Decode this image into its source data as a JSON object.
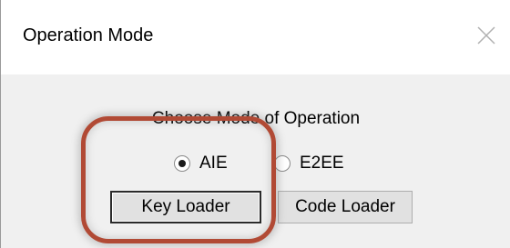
{
  "window": {
    "title": "Operation Mode",
    "close_icon": "close-icon"
  },
  "content": {
    "prompt": "Choose Mode of Operation",
    "radios": [
      {
        "label": "AIE",
        "selected": true
      },
      {
        "label": "E2EE",
        "selected": false
      }
    ],
    "buttons": {
      "key_loader": "Key Loader",
      "code_loader": "Code Loader"
    }
  },
  "colors": {
    "highlight": "#b14a35",
    "dialog_bg": "#f0f0f0",
    "titlebar_bg": "#ffffff"
  }
}
